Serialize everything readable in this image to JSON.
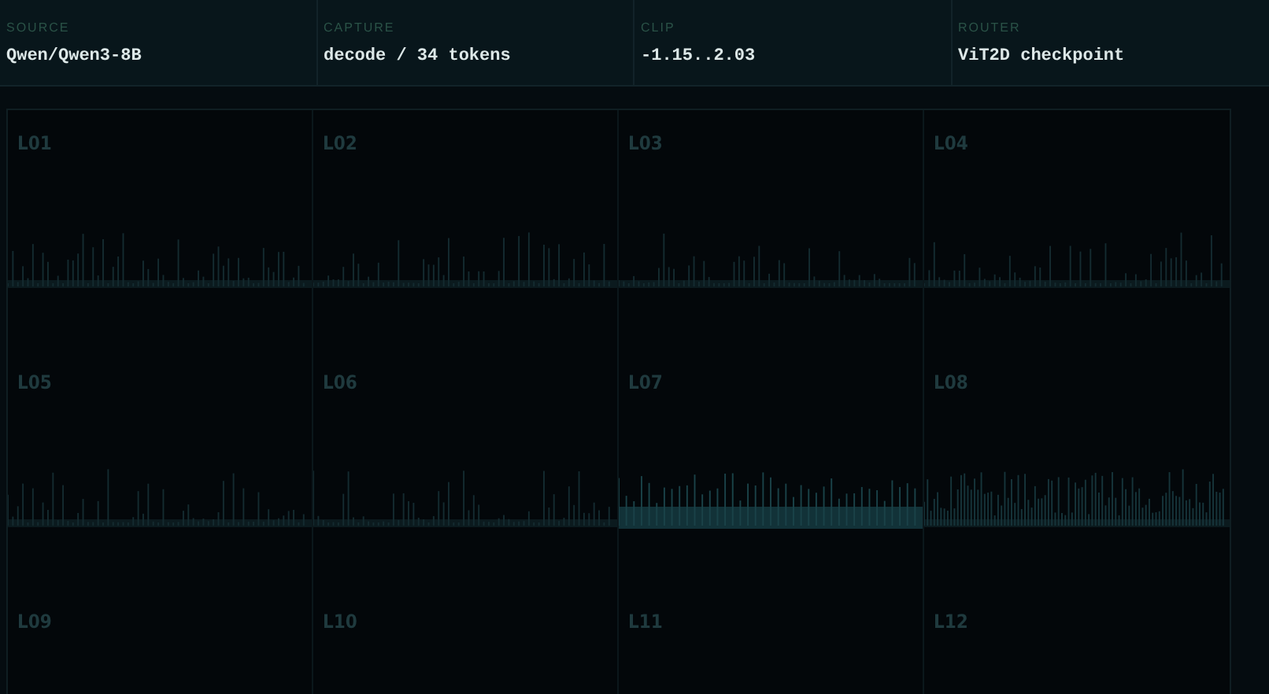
{
  "header": [
    {
      "label": "SOURCE",
      "value": "Qwen/Qwen3-8B"
    },
    {
      "label": "CAPTURE",
      "value": "decode / 34 tokens"
    },
    {
      "label": "CLIP",
      "value": "-1.15..2.03"
    },
    {
      "label": "ROUTER",
      "value": "ViT2D checkpoint"
    }
  ],
  "layers": [
    {
      "label": "L01",
      "kind": "spikes"
    },
    {
      "label": "L02",
      "kind": "spikes"
    },
    {
      "label": "L03",
      "kind": "spikes"
    },
    {
      "label": "L04",
      "kind": "spikes"
    },
    {
      "label": "L05",
      "kind": "spikes"
    },
    {
      "label": "L06",
      "kind": "spikes"
    },
    {
      "label": "L07",
      "kind": "band"
    },
    {
      "label": "L08",
      "kind": "dense"
    },
    {
      "label": "L09",
      "kind": "empty"
    },
    {
      "label": "L10",
      "kind": "empty"
    },
    {
      "label": "L11",
      "kind": "empty"
    },
    {
      "label": "L12",
      "kind": "empty"
    }
  ]
}
